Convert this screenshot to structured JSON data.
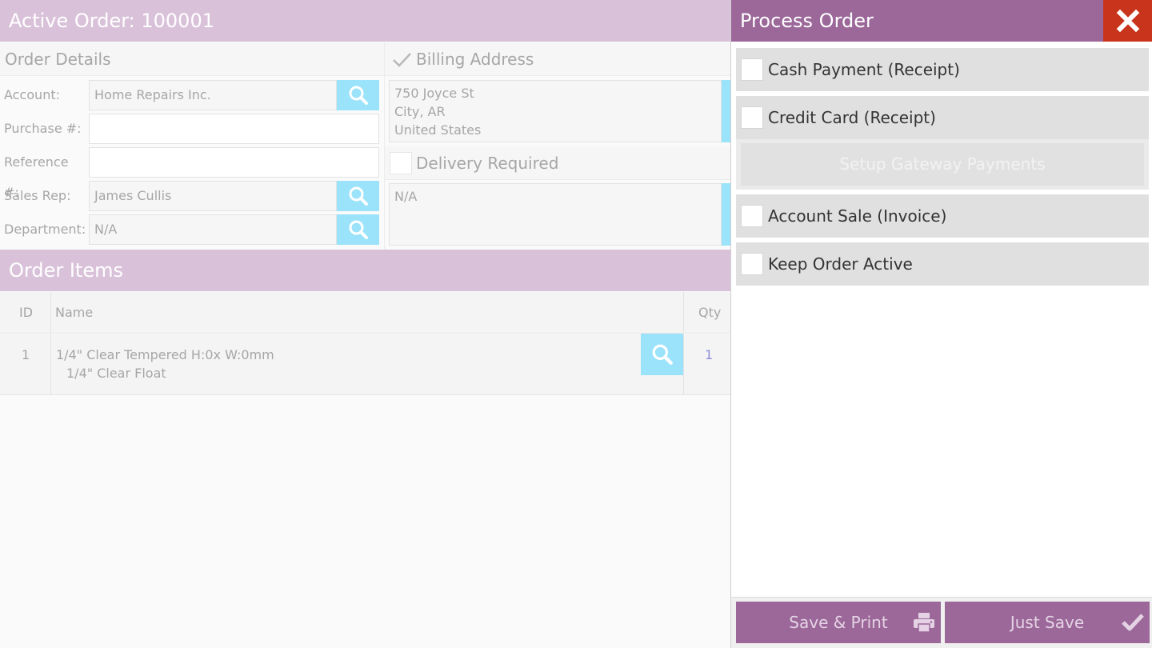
{
  "order": {
    "title": "Active Order: 100001",
    "details_heading": "Order Details",
    "fields": {
      "account": {
        "label": "Account:",
        "value": "Home Repairs Inc."
      },
      "purchase": {
        "label": "Purchase #:",
        "value": ""
      },
      "reference": {
        "label": "Reference #:",
        "value": ""
      },
      "sales_rep": {
        "label": "Sales Rep:",
        "value": "James Cullis"
      },
      "department": {
        "label": "Department:",
        "value": "N/A"
      }
    },
    "billing": {
      "label": "Billing Address",
      "checked": true,
      "lines": [
        "750 Joyce St",
        "City, AR",
        "United States"
      ]
    },
    "delivery": {
      "label": "Delivery Required",
      "checked": false,
      "text": "N/A"
    }
  },
  "items": {
    "heading": "Order Items",
    "columns": {
      "id": "ID",
      "name": "Name",
      "qty": "Qty"
    },
    "rows": [
      {
        "id": "1",
        "name": "1/4\" Clear Tempered  H:0x W:0mm",
        "sub": "1/4\" Clear Float",
        "qty": "1"
      }
    ]
  },
  "process": {
    "title": "Process Order",
    "options": [
      "Cash Payment (Receipt)",
      "Credit Card (Receipt)",
      "Account Sale (Invoice)",
      "Keep Order Active"
    ],
    "gateway_label": "Setup Gateway Payments",
    "save_print_label": "Save & Print",
    "just_save_label": "Just Save"
  },
  "colors": {
    "band_light": "#d9c2d9",
    "band_dark": "#9b6899",
    "accent_search": "#9be3fa",
    "close_red": "#c8341c"
  },
  "icons": {
    "search": "search-icon",
    "close": "close-icon",
    "check": "check-icon",
    "print": "printer-icon"
  }
}
